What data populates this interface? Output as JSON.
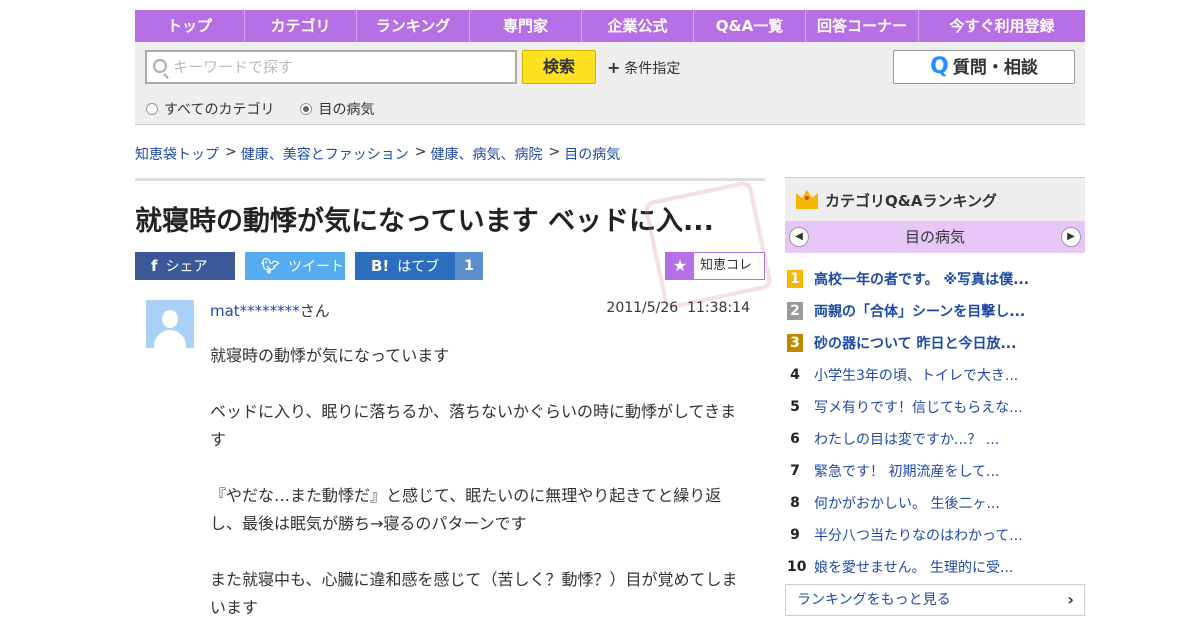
{
  "nav": {
    "items": [
      {
        "label": "トップ"
      },
      {
        "label": "カテゴリ"
      },
      {
        "label": "ランキング"
      },
      {
        "label": "専門家"
      },
      {
        "label": "企業公式"
      },
      {
        "label": "Q&A一覧"
      },
      {
        "label": "回答コーナー"
      },
      {
        "label": "今すぐ利用登録"
      }
    ]
  },
  "search": {
    "placeholder": "キーワードで探す",
    "button_label": "検索",
    "condition_label": "条件指定",
    "ask_button_label": "質問・相談",
    "ask_button_letter": "Q",
    "scope_options": [
      {
        "label": "すべてのカテゴリ",
        "selected": false
      },
      {
        "label": "目の病気",
        "selected": true
      }
    ]
  },
  "breadcrumb": [
    {
      "label": "知恵袋トップ"
    },
    {
      "label": "健康、美容とファッション"
    },
    {
      "label": "健康、病気、病院"
    },
    {
      "label": "目の病気"
    }
  ],
  "question": {
    "title": "就寝時の動悸が気になっています ベッドに入...",
    "share": {
      "facebook_label": "シェア",
      "twitter_label": "ツイート",
      "hatena_label": "はてブ",
      "hatena_count": "1",
      "chiekore_label": "知恵コレ"
    },
    "user_name": "mat********",
    "user_suffix": "さん",
    "date": "2011/5/26",
    "time": "11:38:14",
    "paragraphs": [
      "就寝時の動悸が気になっています",
      "ベッドに入り、眠りに落ちるか、落ちないかぐらいの時に動悸がしてきます",
      "『やだな…また動悸だ』と感じて、眠たいのに無理やり起きてと繰り返し、最後は眠気が勝ち→寝るのパターンです",
      "また就寝中も、心臓に違和感を感じて（苦しく？動悸？）目が覚めてしまいます"
    ]
  },
  "ranking": {
    "title": "カテゴリQ&Aランキング",
    "category": "目の病気",
    "items": [
      {
        "rank": "1",
        "text": "高校一年の者です。 ※写真は僕..."
      },
      {
        "rank": "2",
        "text": "両親の「合体」シーンを目撃し..."
      },
      {
        "rank": "3",
        "text": "砂の器について 昨日と今日放..."
      },
      {
        "rank": "4",
        "text": "小学生3年の頃、トイレで大き..."
      },
      {
        "rank": "5",
        "text": "写メ有りです！信じてもらえな..."
      },
      {
        "rank": "6",
        "text": "わたしの目は変ですか...？ ..."
      },
      {
        "rank": "7",
        "text": "緊急です！ 初期流産をして..."
      },
      {
        "rank": "8",
        "text": "何かがおかしい。 生後二ヶ..."
      },
      {
        "rank": "9",
        "text": "半分八つ当たりなのはわかって..."
      },
      {
        "rank": "10",
        "text": "娘を愛せません。 生理的に受..."
      }
    ],
    "medal_colors": [
      "#f5b800",
      "#9a9a9a",
      "#c08a00"
    ],
    "more_label": "ランキングをもっと見る"
  },
  "colors": {
    "accent": "#b76fe6",
    "link": "#1d4aa8",
    "search_button": "#ffe11f"
  }
}
